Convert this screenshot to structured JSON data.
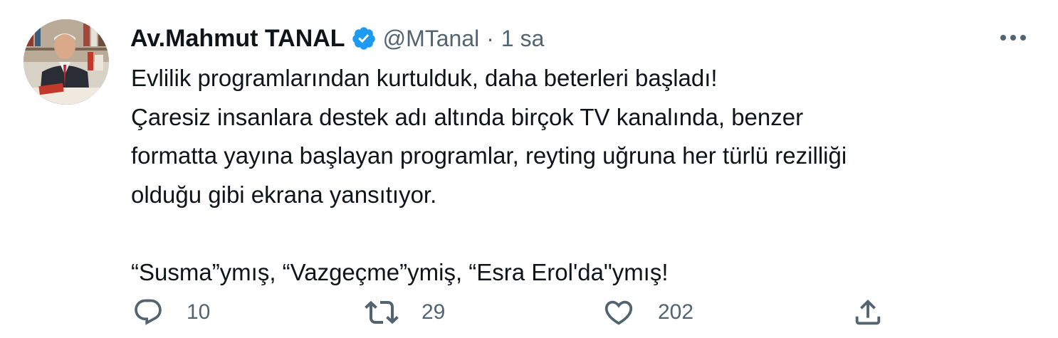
{
  "author": {
    "display_name": "Av.Mahmut TANAL",
    "handle": "@MTanal",
    "separator": "·",
    "time": "1 sa",
    "verified": true,
    "verified_color": "#1d9bf0"
  },
  "tweet": {
    "lines": [
      "Evlilik programlarından kurtulduk, daha beterleri başladı!",
      "Çaresiz insanlara destek adı altında birçok TV kanalında, benzer",
      "formatta yayına başlayan programlar, reyting uğruna her türlü rezilliği",
      "olduğu gibi ekrana yansıtıyor."
    ],
    "last_line": "“Susma”ymış, “Vazgeçme”ymiş, “Esra Erol'da\"ymış!"
  },
  "actions": {
    "reply": {
      "icon": "reply-icon",
      "count": "10"
    },
    "retweet": {
      "icon": "retweet-icon",
      "count": "29"
    },
    "like": {
      "icon": "heart-icon",
      "count": "202"
    },
    "share": {
      "icon": "share-icon"
    }
  },
  "colors": {
    "text_primary": "#0f1419",
    "text_secondary": "#536471",
    "accent": "#1d9bf0"
  }
}
